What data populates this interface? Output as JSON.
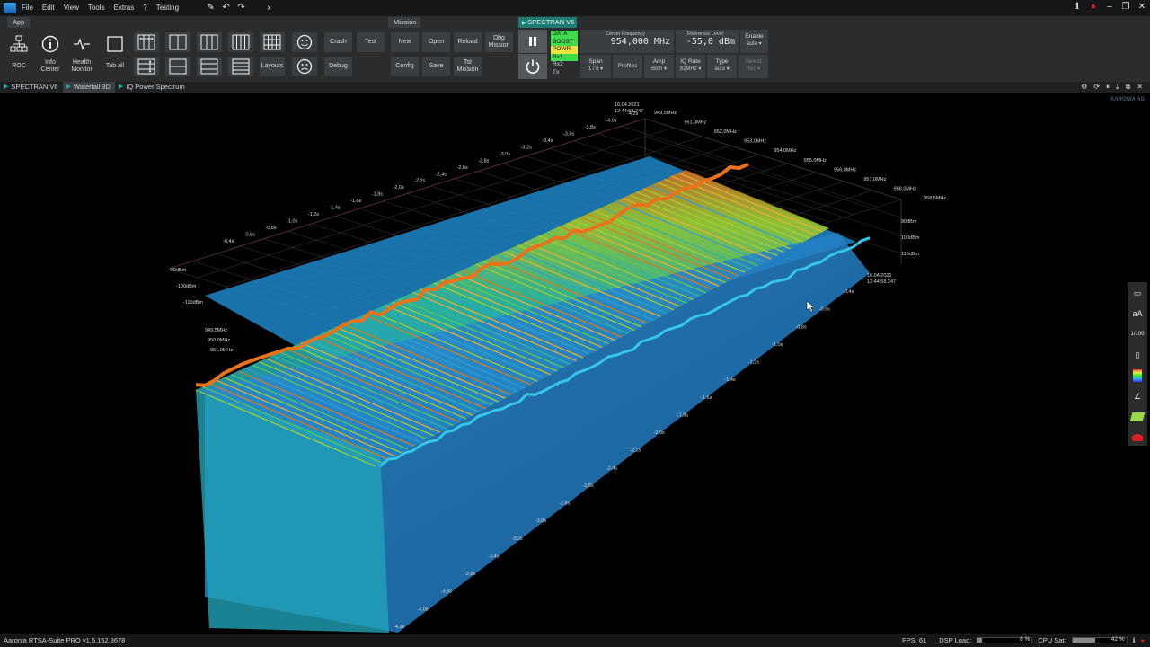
{
  "menubar": {
    "items": [
      "File",
      "Edit",
      "View",
      "Tools",
      "Extras",
      "?",
      "Testing"
    ],
    "close_label": "x"
  },
  "ribbon": {
    "groups": {
      "app": "App",
      "mission": "Mission"
    },
    "app_buttons": [
      {
        "label": "ROC",
        "icon": "network-icon"
      },
      {
        "label": "Info Center",
        "icon": "info-icon"
      },
      {
        "label": "Health Monitor",
        "icon": "pulse-icon"
      },
      {
        "label": "Tab all",
        "icon": "square-icon"
      }
    ],
    "layouts_label": "Layouts",
    "crash_label": "Crash",
    "test_label": "Test",
    "debug_label": "Debug",
    "mission_buttons": [
      "New",
      "Open",
      "Reload",
      "Dbg Mission",
      "Config",
      "Save",
      "Tst Mission"
    ]
  },
  "spectran": {
    "tab_label": "SPECTRAN V6",
    "status_items": [
      {
        "label": "DATA",
        "color": "#3ddc4a"
      },
      {
        "label": "BOOST",
        "color": "#3ddc4a"
      },
      {
        "label": "POWR",
        "color": "#f0e23c"
      },
      {
        "label": "Rx1",
        "color": "#3ddc4a"
      },
      {
        "label": "Rx2",
        "color": ""
      },
      {
        "label": "Tx",
        "color": ""
      }
    ],
    "center_frequency": {
      "caption": "Center Frequency",
      "value": "954,000 MHz"
    },
    "reference_level": {
      "caption": "Reference Level",
      "value": "-55,0 dBm"
    },
    "enable": {
      "caption": "Enable",
      "value": "auto"
    },
    "span": {
      "caption": "Span",
      "value": "1 / 8"
    },
    "profiles_label": "Profiles",
    "amp": {
      "caption": "Amp",
      "value": "Both"
    },
    "iq_rate": {
      "caption": "IQ Rate",
      "value": "92MHz"
    },
    "type": {
      "caption": "Type",
      "value": "auto"
    },
    "select": {
      "caption": "Select",
      "value": "Rx1"
    }
  },
  "view_tabs": [
    "SPECTRAN V6",
    "Waterfall 3D",
    "IQ Power Spectrum"
  ],
  "plot": {
    "timestamp_top_date": "16.04.2021",
    "timestamp_top_time": "12:44:58.247",
    "timestamp_right_date": "16.04.2021",
    "timestamp_right_time": "12:44:58.247",
    "freq_labels": [
      "949,5MHz",
      "951,0MHz",
      "952,0MHz",
      "953,0MHz",
      "954,0MHz",
      "955,0MHz",
      "956,0MHz",
      "957,0MHz",
      "958,0MHz",
      "958,5MHz"
    ],
    "level_labels_left": [
      "-90dBm",
      "-100dBm",
      "-110dBm"
    ],
    "level_labels_right": [
      "90dBm",
      "100dBm",
      "110dBm"
    ],
    "time_labels_top": [
      "-0,4s",
      "-0,6s",
      "-0,8s",
      "-1,0s",
      "-1,2s",
      "-1,4s",
      "-1,6s",
      "-1,8s",
      "-2,0s",
      "-2,2s",
      "-2,4s",
      "-2,6s",
      "-2,8s",
      "-3,0s",
      "-3,2s",
      "-3,4s",
      "-3,6s",
      "-3,8s",
      "-4,0s",
      "-4,2s"
    ],
    "time_labels_right": [
      "-0,4s",
      "-0,6s",
      "-0,8s",
      "-1,0s",
      "-1,2s",
      "-1,4s",
      "-1,6s",
      "-1,8s",
      "-2,0s",
      "-2,2s",
      "-2,4s",
      "-2,6s",
      "-2,8s",
      "-3,0s",
      "-3,2s",
      "-3,4s",
      "-3,6s",
      "-3,8s",
      "-4,0s",
      "-4,2s"
    ],
    "freq_labels_left": [
      "949,5MHz",
      "950,0MHz",
      "951,0MHz"
    ],
    "brand": "AARONIA AG"
  },
  "side_tools": [
    "screenshot-icon",
    "font-size-icon",
    "scale-icon",
    "frame-icon",
    "color-palette-icon",
    "angle-icon",
    "map-icon",
    "marker-icon"
  ],
  "side_labels": {
    "font": "aA",
    "scale": "1/100"
  },
  "statusbar": {
    "version": "Aaronia RTSA-Suite PRO v1.5.152.8678",
    "fps": "FPS: 61",
    "dsp_label": "DSP Load:",
    "dsp_value": "8 %",
    "dsp_fraction": 0.08,
    "cpu_label": "CPU Sat:",
    "cpu_value": "42 %",
    "cpu_fraction": 0.42
  }
}
